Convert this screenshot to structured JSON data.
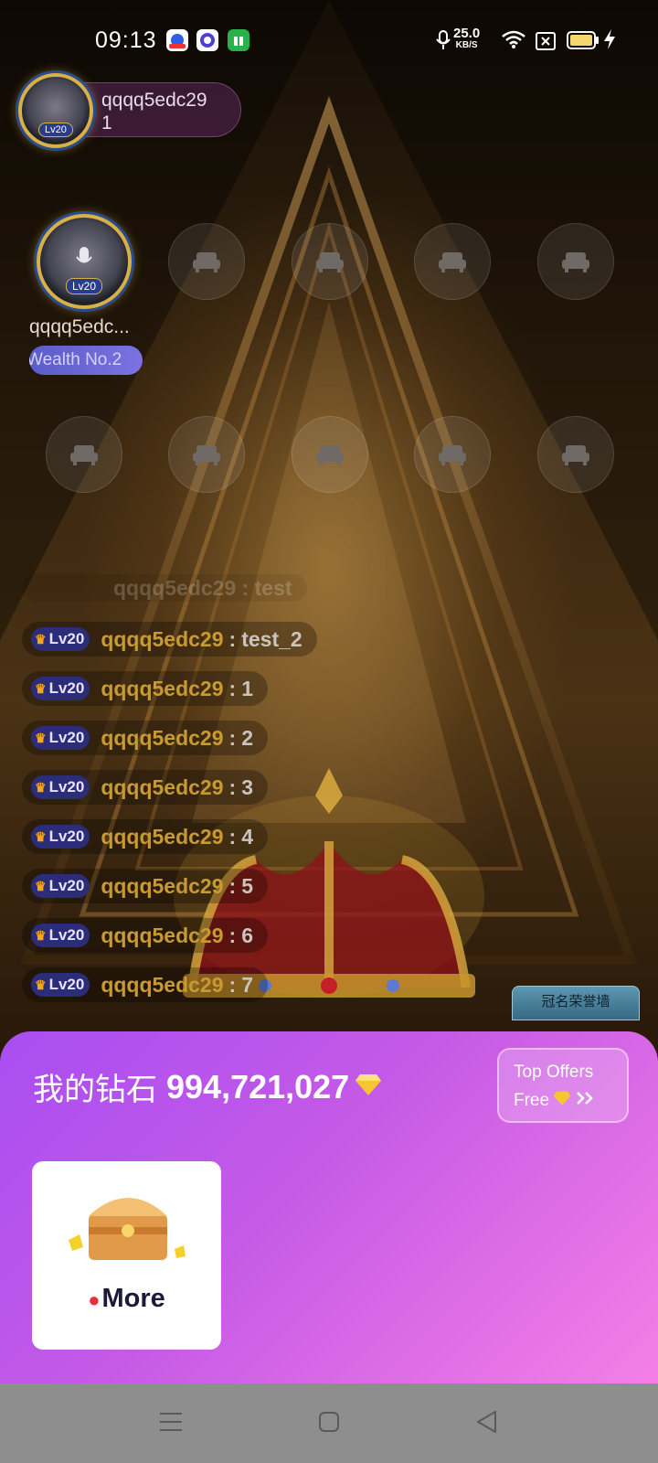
{
  "status_bar": {
    "time": "09:13",
    "net_speed": "25.0",
    "net_unit": "KB/S",
    "icons": [
      "baidu-app-icon",
      "browser-app-icon",
      "gift-app-icon",
      "mic-icon",
      "wifi-icon",
      "sim-off-icon",
      "battery-icon",
      "charging-icon"
    ],
    "battery_color": "#f5d76e"
  },
  "room": {
    "owner_name": "qqqq5edc29",
    "owner_id": "1",
    "owner_level": "Lv20",
    "host_level": "Lv20",
    "host_name": "qqqq5edc...",
    "host_badge": "Wealth No.2",
    "seat_icon": "sofa-icon",
    "honor_wall_label": "冠名荣誉墙"
  },
  "chat": {
    "partial_line": "qqqq5edc29 : test",
    "messages": [
      {
        "level": "Lv20",
        "user": "qqqq5edc29",
        "text": "test_2"
      },
      {
        "level": "Lv20",
        "user": "qqqq5edc29",
        "text": "1"
      },
      {
        "level": "Lv20",
        "user": "qqqq5edc29",
        "text": "2"
      },
      {
        "level": "Lv20",
        "user": "qqqq5edc29",
        "text": "3"
      },
      {
        "level": "Lv20",
        "user": "qqqq5edc29",
        "text": "4"
      },
      {
        "level": "Lv20",
        "user": "qqqq5edc29",
        "text": "5"
      },
      {
        "level": "Lv20",
        "user": "qqqq5edc29",
        "text": "6"
      },
      {
        "level": "Lv20",
        "user": "qqqq5edc29",
        "text": "7"
      }
    ],
    "separator": ":"
  },
  "sheet": {
    "diamonds_label": "我的钻石",
    "diamonds_value": "994,721,027",
    "offers_line1": "Top Offers",
    "offers_line2": "Free",
    "more_label": "More",
    "colors": {
      "gradient_start": "#a84ef2",
      "gradient_end": "#f47fe6"
    }
  },
  "navbar": {
    "icons": [
      "menu-icon",
      "home-icon",
      "back-icon"
    ]
  }
}
